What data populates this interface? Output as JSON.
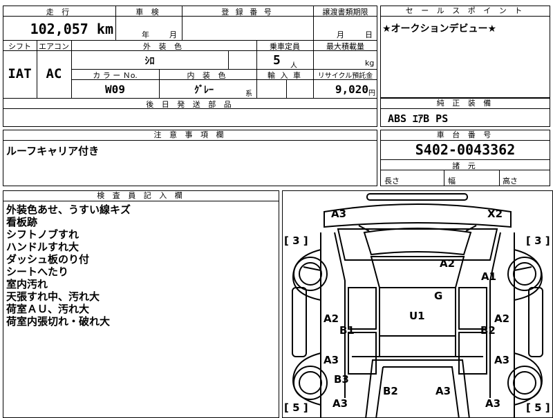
{
  "top": {
    "mileage_label": "走 行",
    "mileage_value": "102,057",
    "mileage_unit": "km",
    "shaken_label": "車 検",
    "shaken_year": "年",
    "shaken_month": "月",
    "reg_label": "登 録 番 号",
    "transfer_label": "譲渡書類期限",
    "transfer_month": "月",
    "transfer_day": "日"
  },
  "middle": {
    "shift_label": "シフト",
    "ac_label": "エアコン",
    "shift_value": "IAT",
    "ac_value": "AC",
    "ext_color_label": "外 装 色",
    "ext_color_value": "ｼﾛ",
    "capacity_label": "乗車定員",
    "capacity_value": "5",
    "capacity_unit": "人",
    "load_label": "最大積載量",
    "load_unit": "kg",
    "color_no_label": "カ ラ ー Ｎo.",
    "color_no_value": "W09",
    "int_color_label": "内 装 色",
    "int_color_value": "ｸﾞﾚｰ",
    "int_color_suffix": "系",
    "import_label": "輸 入 車",
    "recycle_label": "リサイクル預託金",
    "recycle_value": "9,020",
    "recycle_unit": "円",
    "parts_label": "後 日 発 送 部 品"
  },
  "sales": {
    "label": "セ ー ル ス ポ イ ン ト",
    "text": "★オークションデビュー★"
  },
  "equipment": {
    "label": "純 正 装 備",
    "text": "ABS ｴｱB PS"
  },
  "caution": {
    "label": "注 意 事 項 欄",
    "text": "ルーフキャリア付き"
  },
  "chassis": {
    "label": "車 台 番 号",
    "value": "S402-0043362"
  },
  "dims": {
    "label": "諸 元",
    "length": "長さ",
    "width": "幅",
    "height": "高さ"
  },
  "inspector": {
    "label": "検 査 員 記 入 欄",
    "notes": [
      "外装色あせ、うすい線キズ",
      "看板跡",
      "シフトノブすれ",
      "ハンドルすれ大",
      "ダッシュ板のり付",
      "シートへたり",
      "室内汚れ",
      "天張すれ中、汚れ大",
      "荷室ＡＵ、汚れ大",
      "荷室内張切れ・破れ大"
    ]
  },
  "diagram": {
    "tire_fl": "3",
    "tire_fr": "3",
    "tire_rl": "5",
    "tire_rr": "5",
    "marks": [
      "A3",
      "X2",
      "A2",
      "A1",
      "G",
      "U1",
      "A2",
      "B1",
      "A2",
      "B2",
      "A3",
      "A3",
      "B3",
      "A3",
      "B2",
      "A3",
      "A3"
    ]
  }
}
